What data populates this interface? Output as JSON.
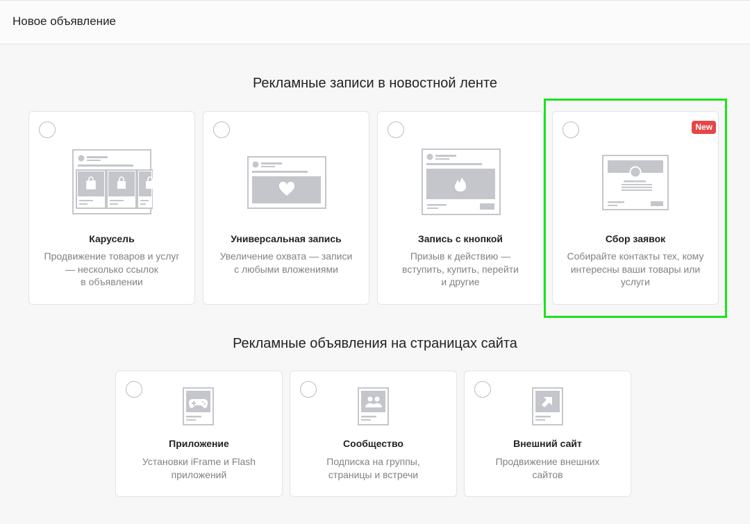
{
  "header": {
    "title": "Новое объявление"
  },
  "sections": [
    {
      "title": "Рекламные записи в новостной ленте",
      "cards": [
        {
          "title": "Карусель",
          "description": "Продвижение товаров и услуг\n— несколько ссылок\nв объявлении",
          "icon": "carousel-illustration"
        },
        {
          "title": "Универсальная запись",
          "description": "Увеличение охвата — записи\nс любыми вложениями",
          "icon": "universal-post-illustration"
        },
        {
          "title": "Запись с кнопкой",
          "description": "Призыв к действию —\nвступить, купить, перейти\nи другие",
          "icon": "button-post-illustration"
        },
        {
          "title": "Сбор заявок",
          "description": "Собирайте контакты тех, кому\nинтересны ваши товары или\nуслуги",
          "icon": "lead-form-illustration",
          "badge": "New"
        }
      ]
    },
    {
      "title": "Рекламные объявления на страницах сайта",
      "cards": [
        {
          "title": "Приложение",
          "description": "Установки iFrame и Flash\nприложений",
          "icon": "gamepad-icon"
        },
        {
          "title": "Сообщество",
          "description": "Подписка на группы,\nстраницы и встречи",
          "icon": "community-icon"
        },
        {
          "title": "Внешний сайт",
          "description": "Продвижение внешних\nсайтов",
          "icon": "external-link-icon"
        }
      ]
    }
  ],
  "colors": {
    "highlight": "#1ae41c",
    "badge": "#e64646",
    "illustration": "#c4c6cb"
  }
}
